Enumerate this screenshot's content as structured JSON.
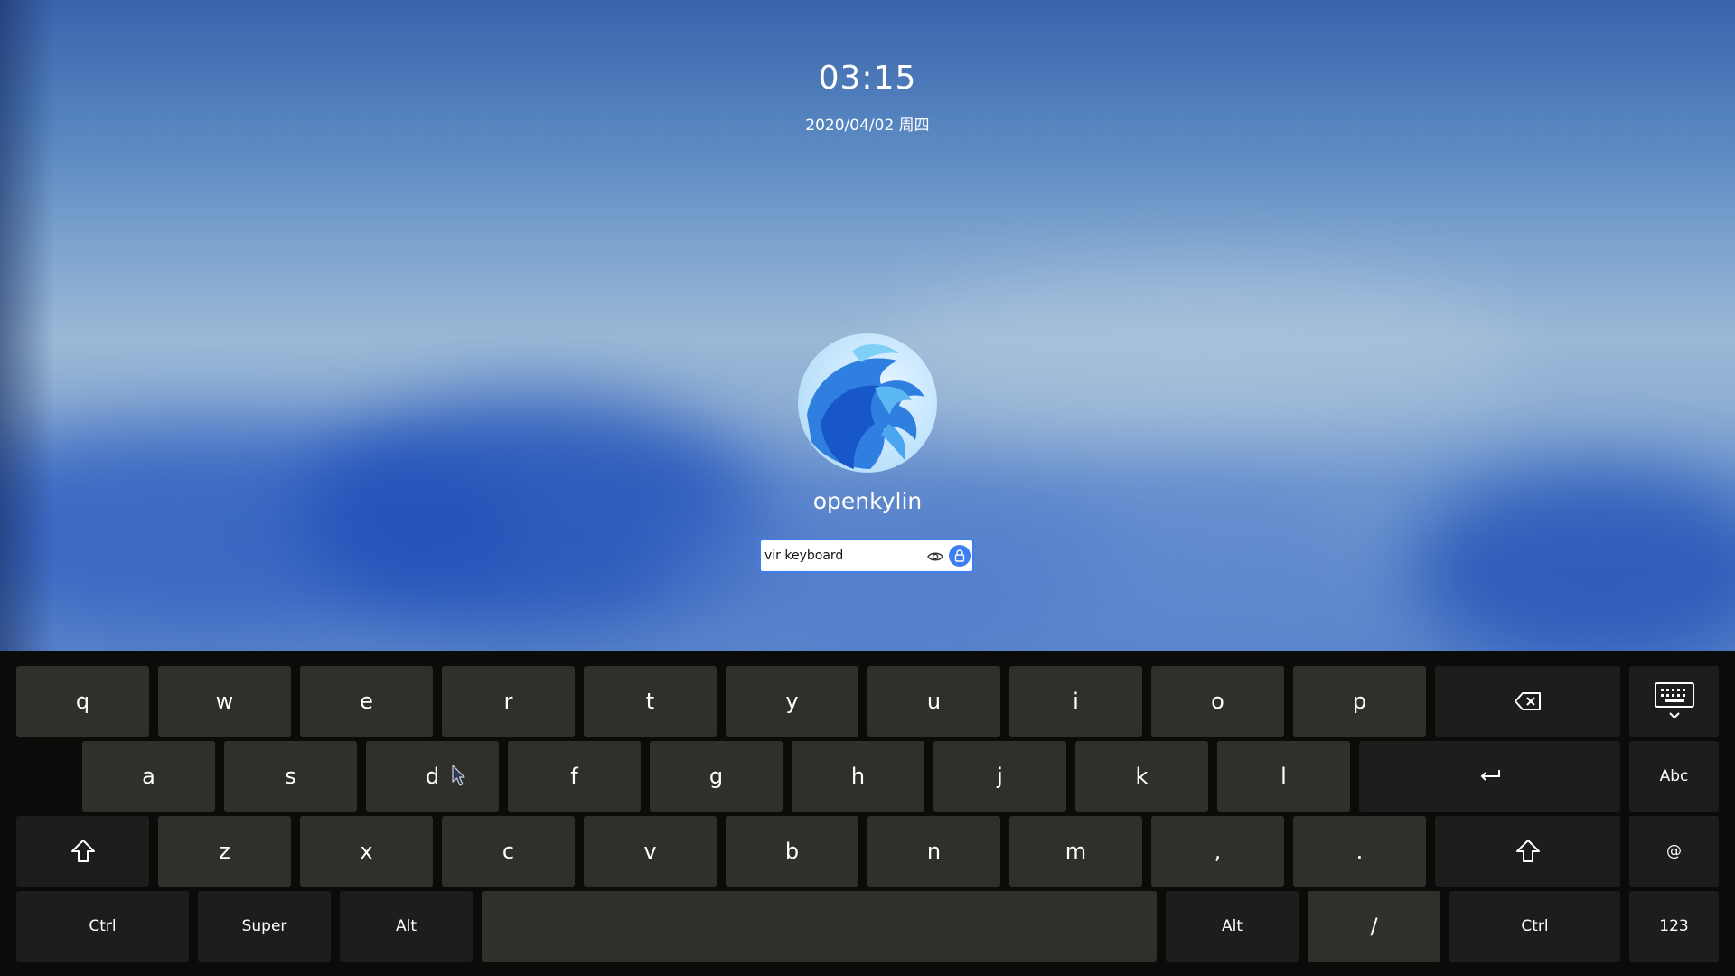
{
  "lockscreen": {
    "time": "03:15",
    "date": "2020/04/02 周四",
    "username": "openkylin",
    "password": {
      "value": "vir keyboard",
      "show_password_icon": "eye-icon",
      "unlock_icon": "lock-icon"
    }
  },
  "keyboard": {
    "row1": [
      "q",
      "w",
      "e",
      "r",
      "t",
      "y",
      "u",
      "i",
      "o",
      "p"
    ],
    "row2": [
      "a",
      "s",
      "d",
      "f",
      "g",
      "h",
      "j",
      "k",
      "l"
    ],
    "row3": [
      "z",
      "x",
      "c",
      "v",
      "b",
      "n",
      "m",
      ",",
      "."
    ],
    "row4": {
      "ctrl_left": "Ctrl",
      "super": "Super",
      "alt_left": "Alt",
      "alt_right": "Alt",
      "slash": "/",
      "ctrl_right": "Ctrl"
    },
    "side": {
      "abc": "Abc",
      "at": "@",
      "num": "123"
    },
    "icons": {
      "backspace": "backspace-icon",
      "hide_keyboard": "keyboard-hide-icon",
      "enter": "enter-icon",
      "shift": "shift-icon"
    }
  },
  "colors": {
    "accent": "#3d7ef0",
    "key_char": "#302f2c",
    "key_mod": "#1e1d1b",
    "keyboard_bg": "#0b0b0a"
  }
}
